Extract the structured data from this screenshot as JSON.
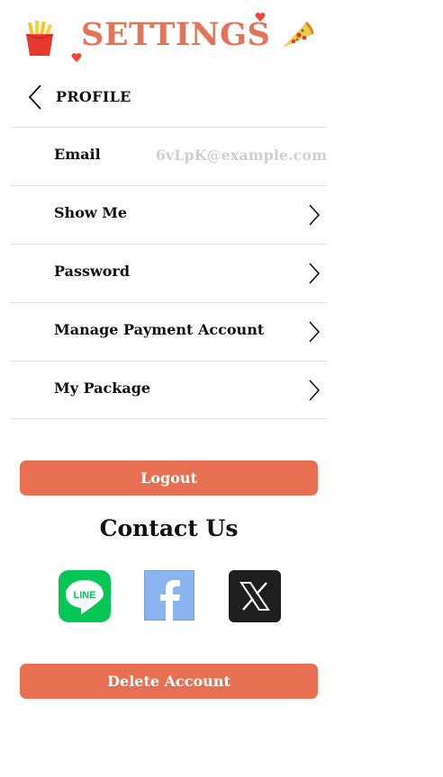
{
  "header": {
    "title": "SETTINGS",
    "left_icon": "fries-icon",
    "right_icon": "pizza-icon",
    "accent": "#e47458"
  },
  "nav": {
    "back_icon": "chevron-left-icon",
    "section": "PROFILE"
  },
  "rows": [
    {
      "label": "Email",
      "value": "6vLpK@example.com"
    },
    {
      "label": "Show Me"
    },
    {
      "label": "Password"
    },
    {
      "label": "Manage Payment Account"
    },
    {
      "label": "My Package"
    }
  ],
  "buttons": {
    "logout": "Logout",
    "delete": "Delete Account",
    "color": "#e87052"
  },
  "contact": {
    "title": "Contact Us",
    "links": [
      {
        "name": "LINE",
        "icon": "line-icon",
        "label": "LINE",
        "color": "#06c755"
      },
      {
        "name": "Facebook",
        "icon": "facebook-icon",
        "color": "#8ab4f0"
      },
      {
        "name": "X",
        "icon": "x-icon",
        "color": "#1e1e1e"
      }
    ]
  }
}
